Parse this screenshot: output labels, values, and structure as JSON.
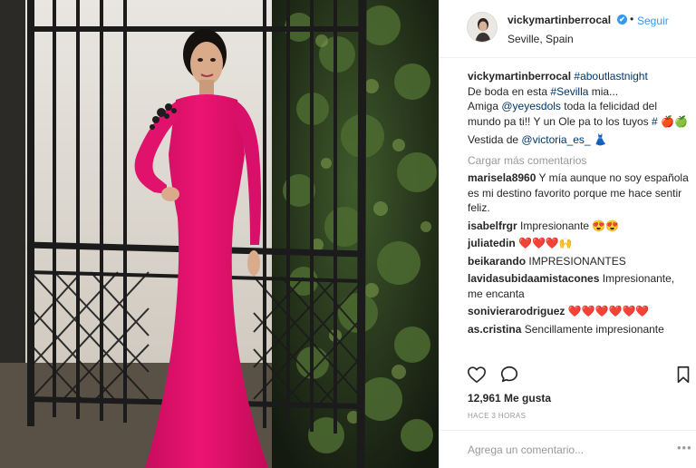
{
  "header": {
    "username": "vickymartinberrocal",
    "follow_label": "Seguir",
    "dot": "•",
    "verified_mark": "✔",
    "location": "Seville, Spain"
  },
  "caption": {
    "username": "vickymartinberrocal",
    "hashtag1": "#aboutlastnight",
    "line2_text": "De boda en esta ",
    "line2_tag": "#Sevilla",
    "line2_end": " mia...",
    "line3_text": "Amiga ",
    "line3_mention": "@yeyesdols",
    "line3_end": " toda la felicidad del mundo pa ti!! Y un Ole pa to los tuyos ",
    "line3_tag": "#",
    "line3_emoji": "🍎🍏",
    "line4_text": "Vestida de ",
    "line4_mention": "@victoria_es_",
    "line4_emoji": "👗"
  },
  "load_more": "Cargar más comentarios",
  "comments": [
    {
      "user": "marisela8960",
      "text": "Y mía aunque no soy española es mi destino favorito porque me hace sentir feliz."
    },
    {
      "user": "isabelfrgr",
      "text": "Impresionante 😍😍"
    },
    {
      "user": "juliatedin",
      "text": "❤️❤️❤️🙌"
    },
    {
      "user": "beikarando",
      "text": "IMPRESIONANTES"
    },
    {
      "user": "lavidasubidaamistacones",
      "text": "Impresionante, me encanta"
    },
    {
      "user": "sonivierarodriguez",
      "text": "❤️❤️❤️❤️❤️❤️"
    },
    {
      "user": "as.cristina",
      "text": "Sencillamente impresionante"
    }
  ],
  "likes": "12,961 Me gusta",
  "time_ago": "HACE 3 HORAS",
  "add_comment_placeholder": "Agrega un comentario...",
  "options_label": "•••",
  "colors": {
    "dress": "#e8126e",
    "link": "#003569",
    "follow": "#3897f0",
    "muted": "#999999"
  }
}
